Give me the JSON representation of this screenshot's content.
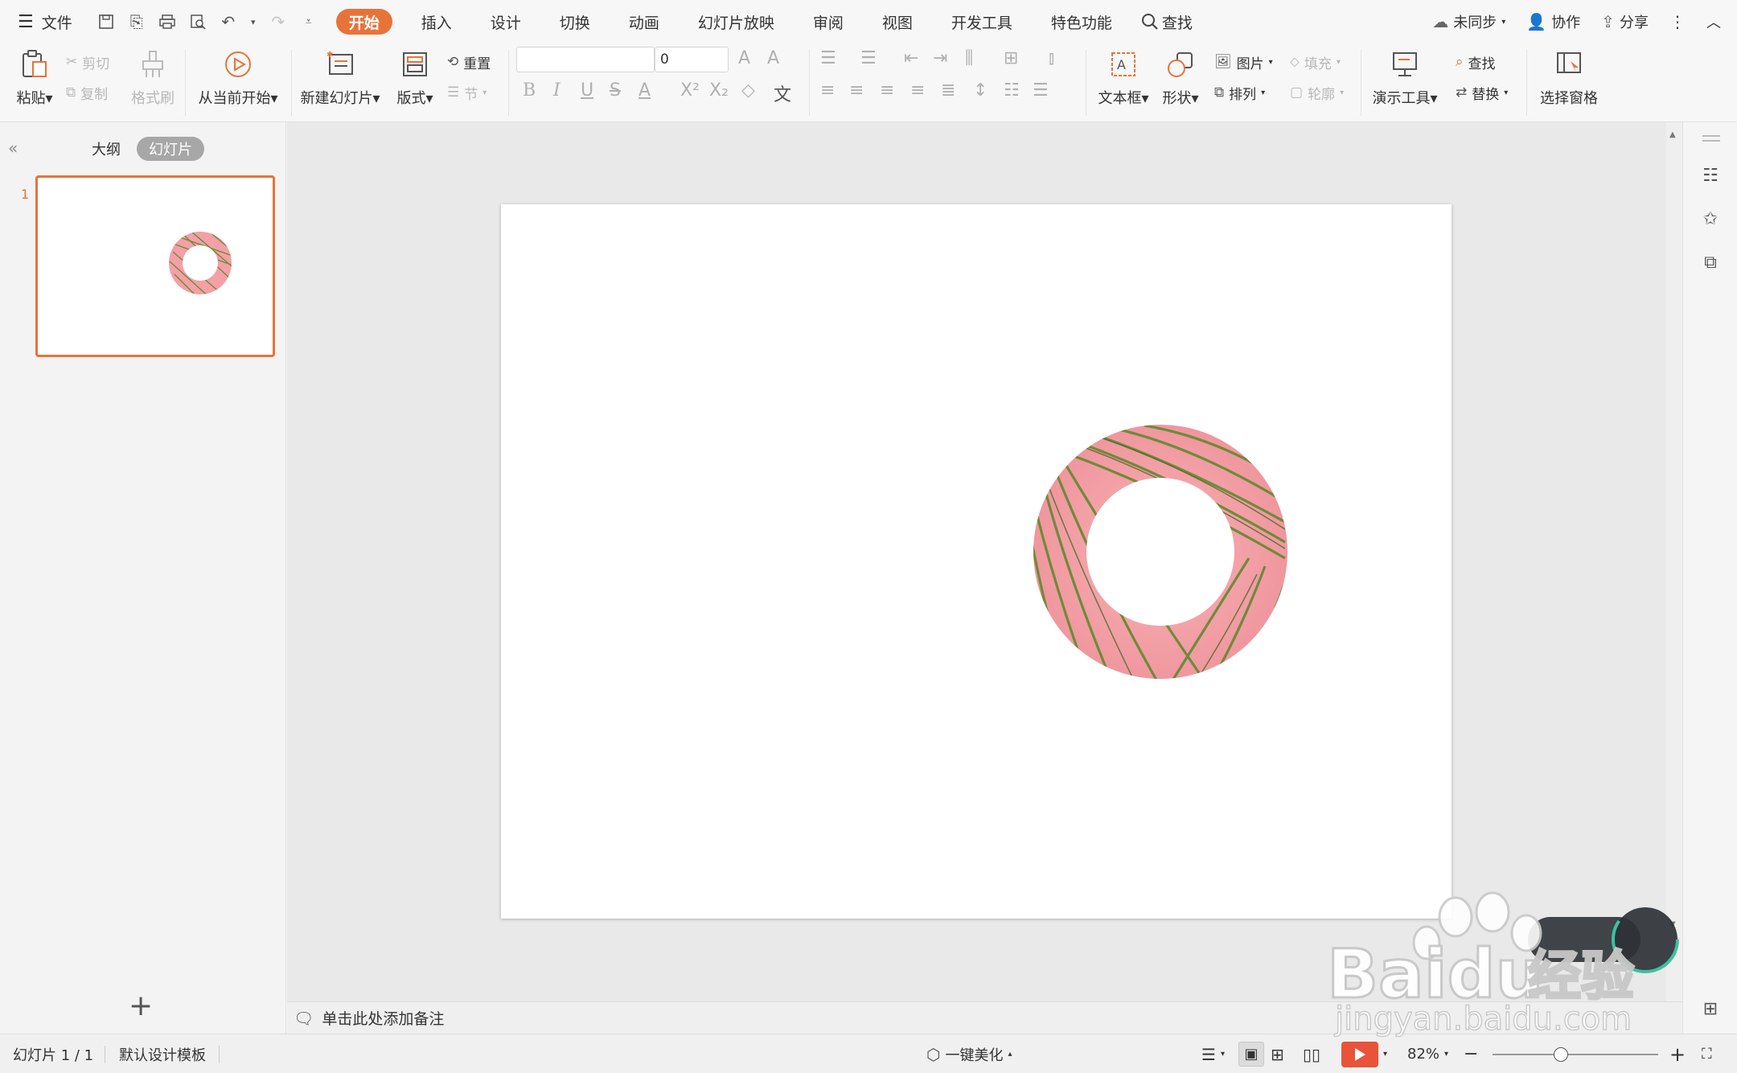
{
  "menu": {
    "file_label": "文件",
    "tabs": [
      "开始",
      "插入",
      "设计",
      "切换",
      "动画",
      "幻灯片放映",
      "审阅",
      "视图",
      "开发工具",
      "特色功能"
    ],
    "search_label": "查找",
    "sync_label": "未同步",
    "collab_label": "协作",
    "share_label": "分享"
  },
  "ribbon": {
    "paste": "粘贴",
    "cut": "剪切",
    "copy": "复制",
    "format_painter": "格式刷",
    "from_current": "从当前开始",
    "new_slide": "新建幻灯片",
    "layout": "版式",
    "reset": "重置",
    "section": "节",
    "font_name": "",
    "font_size": "0",
    "text_box": "文本框",
    "shape": "形状",
    "picture": "图片",
    "fill": "填充",
    "arrange": "排列",
    "outline": "轮廓",
    "presentation_tools": "演示工具",
    "find": "查找",
    "replace": "替换",
    "selection_pane": "选择窗格"
  },
  "left_pane": {
    "outline_tab": "大纲",
    "slides_tab": "幻灯片",
    "slide_number": "1"
  },
  "notes": {
    "placeholder": "单击此处添加备注"
  },
  "status": {
    "slide_info": "幻灯片 1 / 1",
    "template": "默认设计模板",
    "beautify": "一键美化",
    "zoom": "82%"
  },
  "watermark": {
    "brand": "Baidu",
    "brand_cn": "经验",
    "url": "jingyan.baidu.com"
  },
  "colors": {
    "accent": "#e8733a",
    "ring_pink": "#f3a0a6",
    "leaf_green": "#6f8a3a"
  }
}
